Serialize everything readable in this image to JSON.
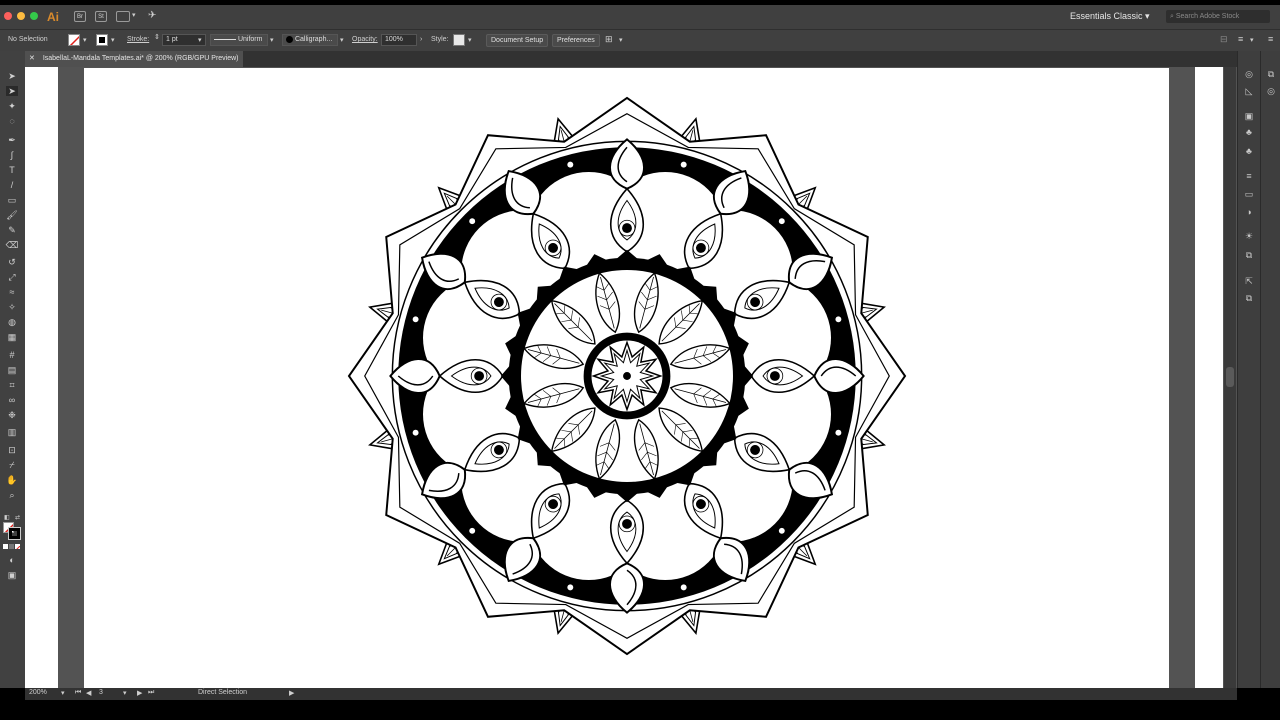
{
  "app": {
    "logo": "Ai",
    "bridge_label": "Br",
    "stock_label": "St",
    "workspace": "Essentials Classic",
    "search_placeholder": "Search Adobe Stock"
  },
  "control_bar": {
    "selection_status": "No Selection",
    "stroke_label": "Stroke:",
    "stroke_value": "1 pt",
    "profile": "Uniform",
    "brush": "Calligraph...",
    "opacity_label": "Opacity:",
    "opacity_value": "100%",
    "style_label": "Style:",
    "document_setup": "Document Setup",
    "preferences": "Preferences"
  },
  "document": {
    "tab_title": "IsabellaL-Mandala Templates.ai* @ 200% (RGB/GPU Preview)"
  },
  "status_bar": {
    "zoom": "200%",
    "artboard_number": "3",
    "current_tool": "Direct Selection"
  },
  "colors": {
    "app_bg": "#404040",
    "canvas_bg": "#535353",
    "artboard": "#ffffff",
    "accent_logo": "#d88a2c"
  }
}
